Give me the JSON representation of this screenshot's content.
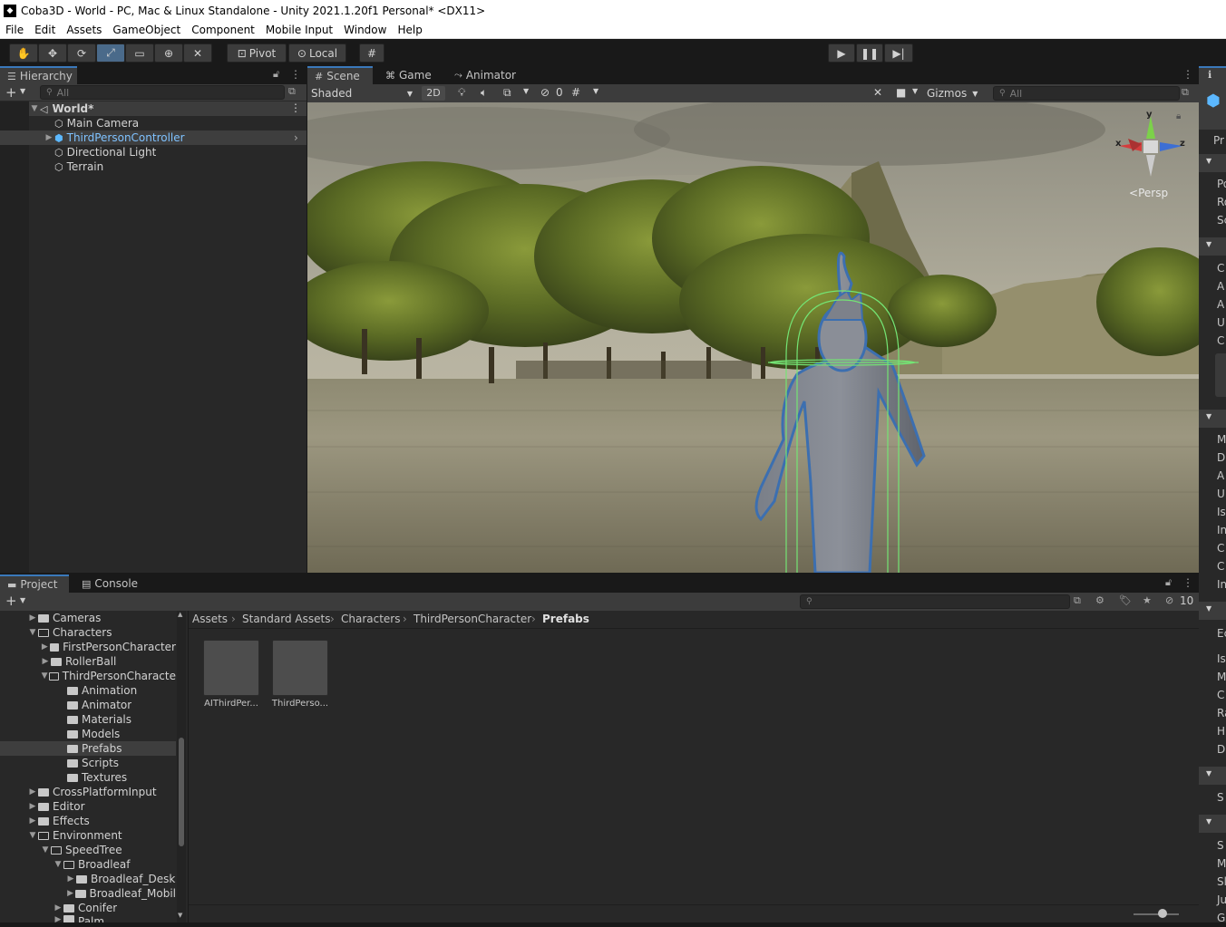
{
  "window_title": "Coba3D - World - PC, Mac & Linux Standalone - Unity 2021.1.20f1 Personal* <DX11>",
  "menu": [
    "File",
    "Edit",
    "Assets",
    "GameObject",
    "Component",
    "Mobile Input",
    "Window",
    "Help"
  ],
  "toolbar": {
    "pivot": "Pivot",
    "local": "Local"
  },
  "hierarchy": {
    "tab": "Hierarchy",
    "search_placeholder": "All",
    "scene": "World*",
    "items": [
      "Main Camera",
      "ThirdPersonController",
      "Directional Light",
      "Terrain"
    ]
  },
  "scene_tabs": {
    "scene": "Scene",
    "game": "Game",
    "animator": "Animator"
  },
  "scene_toolbar": {
    "shading": "Shaded",
    "mode2d": "2D",
    "hidden_count": "0",
    "gizmos": "Gizmos",
    "search_placeholder": "All",
    "persp": "Persp"
  },
  "gizmo_axes": {
    "x": "x",
    "y": "y",
    "z": "z"
  },
  "project": {
    "tab_project": "Project",
    "tab_console": "Console",
    "hidden_count": "10",
    "tree": [
      "Cameras",
      "Characters",
      "FirstPersonCharacter",
      "RollerBall",
      "ThirdPersonCharacte",
      "Animation",
      "Animator",
      "Materials",
      "Models",
      "Prefabs",
      "Scripts",
      "Textures",
      "CrossPlatformInput",
      "Editor",
      "Effects",
      "Environment",
      "SpeedTree",
      "Broadleaf",
      "Broadleaf_Desk",
      "Broadleaf_Mobil",
      "Conifer",
      "Palm"
    ],
    "breadcrumb": [
      "Assets",
      "Standard Assets",
      "Characters",
      "ThirdPersonCharacter",
      "Prefabs"
    ],
    "assets": [
      "AIThirdPer...",
      "ThirdPerso..."
    ]
  },
  "inspector_letters": [
    "Pr",
    "Po",
    "Ro",
    "Sc",
    "C",
    "A",
    "A",
    "U",
    "C",
    "M",
    "D",
    "A",
    "U",
    "Is",
    "In",
    "C",
    "C",
    "In",
    "Ec",
    "Is",
    "M",
    "C",
    "Ra",
    "H",
    "D",
    "S",
    "S",
    "M",
    "Sl",
    "Ju",
    "G"
  ],
  "colors": {
    "accent": "#3a79bb",
    "selection": "#2c5d87",
    "panel": "#282828",
    "chrome": "#191919"
  }
}
